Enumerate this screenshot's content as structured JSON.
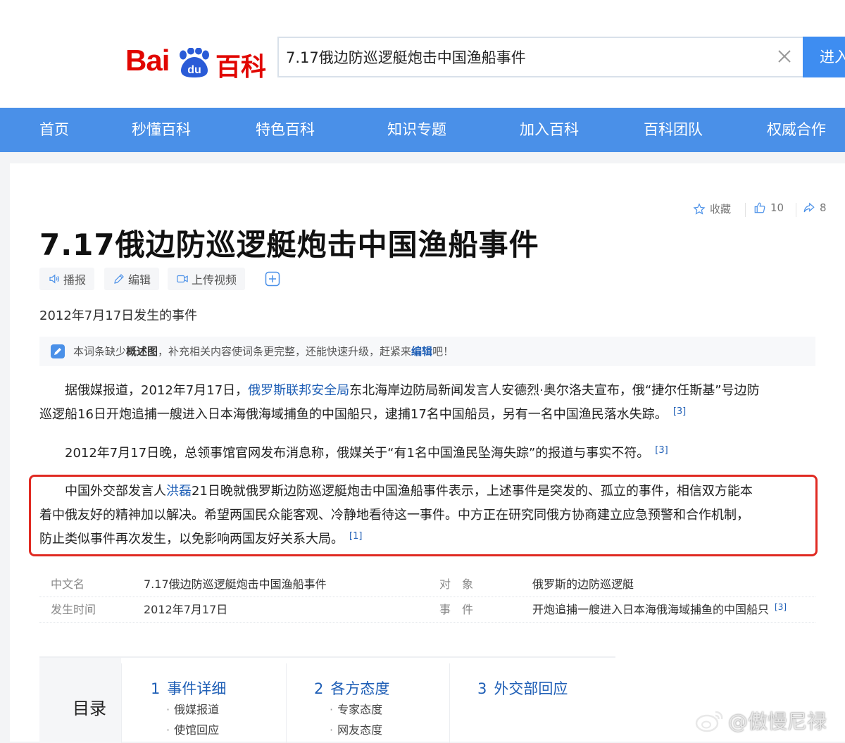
{
  "header": {
    "logo": {
      "bai": "Bai",
      "du": "du",
      "baike": "百科"
    },
    "search": {
      "value": "7.17俄边防巡逻艇炮击中国渔船事件",
      "button_label": "进入"
    }
  },
  "nav": {
    "items": [
      {
        "label": "首页"
      },
      {
        "label": "秒懂百科"
      },
      {
        "label": "特色百科"
      },
      {
        "label": "知识专题"
      },
      {
        "label": "加入百科"
      },
      {
        "label": "百科团队"
      },
      {
        "label": "权威合作"
      }
    ]
  },
  "article": {
    "actions": {
      "favorite": "收藏",
      "likes": "10",
      "shares": "8"
    },
    "title": "7.17俄边防巡逻艇炮击中国渔船事件",
    "tools": {
      "broadcast": "播报",
      "edit": "编辑",
      "upload_video": "上传视频"
    },
    "summary": "2012年7月17日发生的事件",
    "notice": {
      "prefix": "本词条缺少",
      "bold": "概述图",
      "middle": "，补充相关内容使词条更完整，还能快速升级，赶紧来",
      "link": "编辑",
      "suffix": "吧！"
    },
    "para1": {
      "l1_pre": "据俄媒报道，2012年7月17日，",
      "l1_link": "俄罗斯联邦安全局",
      "l1_post": "东北海岸边防局新闻发言人安德烈·奥尔洛夫宣布，俄“捷尔任斯基”号边防",
      "l2": "巡逻船16日开炮追捕一艘进入日本海俄海域捕鱼的中国船只，逮捕17名中国船员，另有一名中国渔民落水失踪。",
      "ref": "[3]"
    },
    "para2": {
      "text": "2012年7月17日晚，总领事馆官网发布消息称，俄媒关于“有1名中国渔民坠海失踪”的报道与事实不符。",
      "ref": "[3]"
    },
    "para3": {
      "l1_pre": "中国外交部发言人",
      "l1_link": "洪磊",
      "l1_post": "21日晚就俄罗斯边防巡逻艇炮击中国渔船事件表示，上述事件是突发的、孤立的事件，相信双方能本",
      "l2": "着中俄友好的精神加以解决。希望两国民众能客观、冷静地看待这一事件。中方正在研究同俄方协商建立应急预警和合作机制，",
      "l3": "防止类似事件再次发生，以免影响两国友好关系大局。",
      "ref": "[1]"
    },
    "info": {
      "row1": {
        "k1": "中文名",
        "v1": "7.17俄边防巡逻艇炮击中国渔船事件",
        "k2": "对　象",
        "v2": "俄罗斯的边防巡逻艇"
      },
      "row2": {
        "k1": "发生时间",
        "v1": "2012年7月17日",
        "k2": "事　件",
        "v2": "开炮追捕一艘进入日本海俄海域捕鱼的中国船只",
        "ref": "[3]"
      }
    },
    "catalog": {
      "title": "目录",
      "sections": [
        {
          "num": "1",
          "label": "事件详细",
          "subs": [
            "俄媒报道",
            "使馆回应"
          ]
        },
        {
          "num": "2",
          "label": "各方态度",
          "subs": [
            "专家态度",
            "网友态度"
          ]
        },
        {
          "num": "3",
          "label": "外交部回应",
          "subs": []
        }
      ]
    }
  },
  "watermark": "@傲慢尼禄",
  "colors": {
    "brand_red": "#e10601",
    "nav_blue": "#4a90e8",
    "link_blue": "#1f5fb6",
    "highlight_red": "#e02a22"
  }
}
